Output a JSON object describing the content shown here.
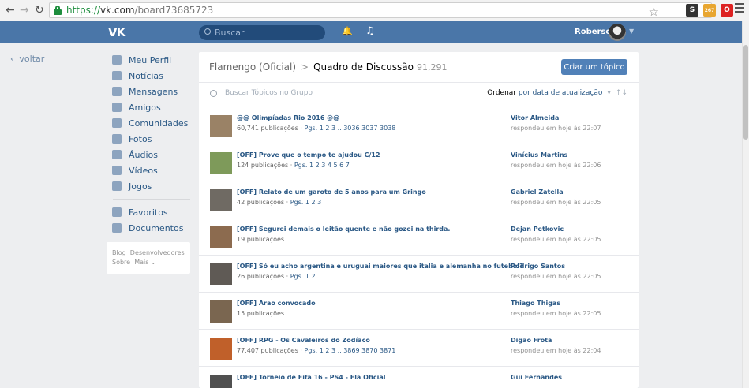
{
  "browser": {
    "back_icon": "arrow-left-icon",
    "forward_icon": "arrow-right-icon",
    "reload_icon": "reload-icon",
    "url_scheme": "https://",
    "url_host": "vk.com",
    "url_path": "/board73685723",
    "ext_badge": "267"
  },
  "header": {
    "logo": "VK",
    "search_placeholder": "Buscar",
    "user_name": "Roberson"
  },
  "back_label": "voltar",
  "sidebar": {
    "items": [
      {
        "label": "Meu Perfil",
        "icon": "home-icon"
      },
      {
        "label": "Notícias",
        "icon": "news-icon"
      },
      {
        "label": "Mensagens",
        "icon": "messages-icon"
      },
      {
        "label": "Amigos",
        "icon": "friends-icon"
      },
      {
        "label": "Comunidades",
        "icon": "communities-icon"
      },
      {
        "label": "Fotos",
        "icon": "camera-icon"
      },
      {
        "label": "Áudios",
        "icon": "music-icon"
      },
      {
        "label": "Vídeos",
        "icon": "video-icon"
      },
      {
        "label": "Jogos",
        "icon": "gamepad-icon"
      }
    ],
    "items2": [
      {
        "label": "Favoritos",
        "icon": "star-icon"
      },
      {
        "label": "Documentos",
        "icon": "document-icon"
      }
    ],
    "footer": {
      "blog": "Blog",
      "devs": "Desenvolvedores",
      "about": "Sobre",
      "more": "Mais ⌄"
    }
  },
  "main": {
    "group": "Flamengo (Oficial)",
    "section": "Quadro de Discussão",
    "count": "91,291",
    "create_button": "Criar um tópico",
    "search_placeholder": "Buscar Tópicos no Grupo",
    "sort_label": "Ordenar",
    "sort_value": "por data de atualização",
    "topics": [
      {
        "title": "@@ Olimpíadas Rio 2016 @@",
        "posts": "60,741 publicações",
        "pages": "Pgs. 1 2 3 .. 3036 3037 3038",
        "author": "Vitor Almeida",
        "time": "respondeu em hoje às 22:07",
        "avatar_color": "#9a8266"
      },
      {
        "title": "[OFF] Prove que o tempo te ajudou C/12",
        "posts": "124 publicações",
        "pages": "Pgs. 1 2 3 4 5 6 7",
        "author": "Vinícius Martins",
        "time": "respondeu em hoje às 22:06",
        "avatar_color": "#7e9a5a"
      },
      {
        "title": "[OFF] Relato de um garoto de 5 anos para um Gringo",
        "posts": "42 publicações",
        "pages": "Pgs. 1 2 3",
        "author": "Gabriel Zatella",
        "time": "respondeu em hoje às 22:05",
        "avatar_color": "#6f6a63"
      },
      {
        "title": "[OFF] Segurei demais o leitão quente e não gozei na thirda.",
        "posts": "19 publicações",
        "pages": "",
        "author": "Dejan Petkovic",
        "time": "respondeu em hoje às 22:05",
        "avatar_color": "#8c6b4f"
      },
      {
        "title": "[OFF] Só eu acho argentina e uruguai maiores que italia e alemanha no futebol?",
        "posts": "26 publicações",
        "pages": "Pgs. 1 2",
        "author": "Rodrigo Santos",
        "time": "respondeu em hoje às 22:05",
        "avatar_color": "#5f5a55"
      },
      {
        "title": "[OFF] Arao convocado",
        "posts": "15 publicações",
        "pages": "",
        "author": "Thiago Thigas",
        "time": "respondeu em hoje às 22:05",
        "avatar_color": "#7a6650"
      },
      {
        "title": "[OFF] RPG - Os Cavaleiros do Zodíaco",
        "posts": "77,407 publicações",
        "pages": "Pgs. 1 2 3 .. 3869 3870 3871",
        "author": "Digão Frota",
        "time": "respondeu em hoje às 22:04",
        "avatar_color": "#c0602a"
      },
      {
        "title": "[OFF] Torneio de Fifa 16 - PS4 - Fla Oficial",
        "posts": "",
        "pages": "",
        "author": "Gui Fernandes",
        "time": "",
        "avatar_color": "#505050"
      }
    ]
  }
}
